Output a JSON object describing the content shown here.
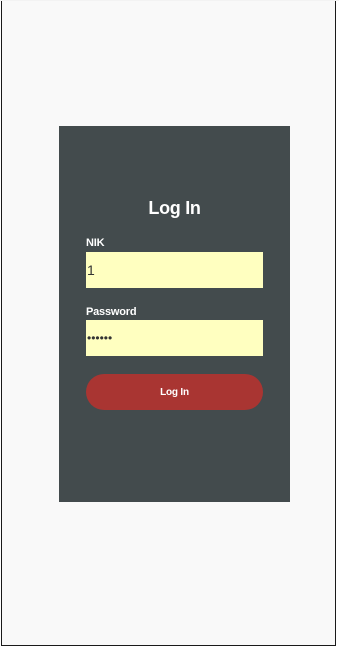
{
  "login": {
    "title": "Log In",
    "nik_label": "NIK",
    "nik_value": "1",
    "password_label": "Password",
    "password_value": "••••••",
    "submit_label": "Log In"
  },
  "colors": {
    "card_bg": "#434b4d",
    "input_bg": "#ffffc0",
    "button_bg": "#a93532",
    "page_bg": "#f9f9f9"
  }
}
